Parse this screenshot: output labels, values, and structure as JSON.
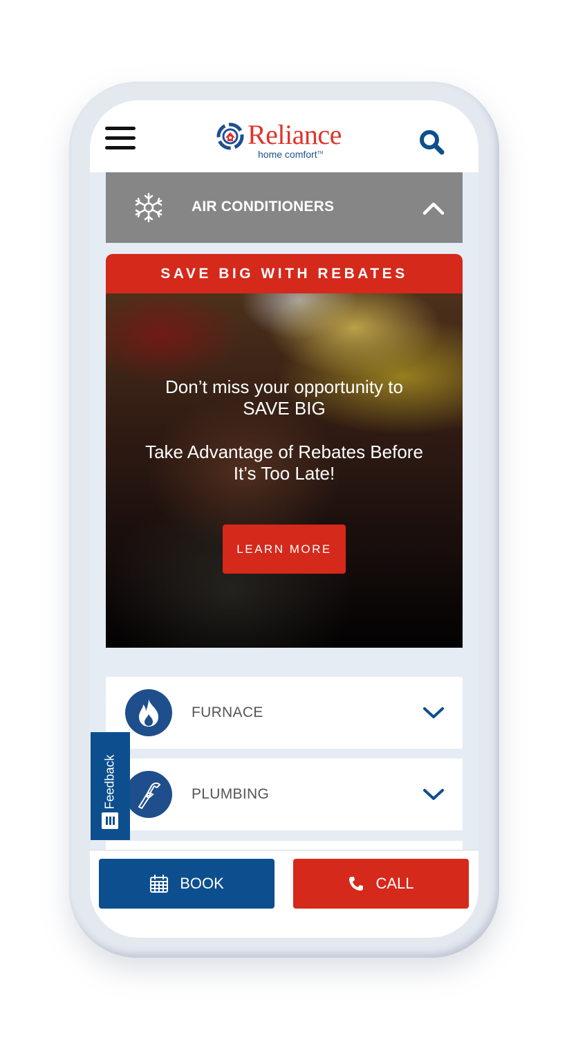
{
  "header": {
    "logo_word": "Reliance",
    "logo_sub": "home comfort",
    "logo_tm": "TM",
    "menu_icon": "hamburger-icon",
    "search_icon": "search-icon"
  },
  "accordion_open": {
    "label": "AIR CONDITIONERS",
    "icon": "snowflake-icon",
    "state_icon": "chevron-up-icon",
    "bg_color": "#868686"
  },
  "promo": {
    "heading": "SAVE BIG WITH REBATES",
    "line1a": "Don’t miss your opportunity to",
    "line1b": "SAVE BIG",
    "line2a": "Take Advantage of Rebates Before",
    "line2b": "It’s Too Late!",
    "cta": "LEARN MORE",
    "accent": "#d5291b"
  },
  "services": [
    {
      "label": "FURNACE",
      "icon": "flame-icon",
      "state_icon": "chevron-down-icon"
    },
    {
      "label": "PLUMBING",
      "icon": "wrench-icon",
      "state_icon": "chevron-down-icon"
    }
  ],
  "feedback": {
    "label": "Feedback",
    "icon": "feedback-icon"
  },
  "bottom_bar": {
    "book": {
      "label": "BOOK",
      "icon": "calendar-icon",
      "color": "#0d4f8e"
    },
    "call": {
      "label": "CALL",
      "icon": "phone-icon",
      "color": "#d5291b"
    }
  }
}
